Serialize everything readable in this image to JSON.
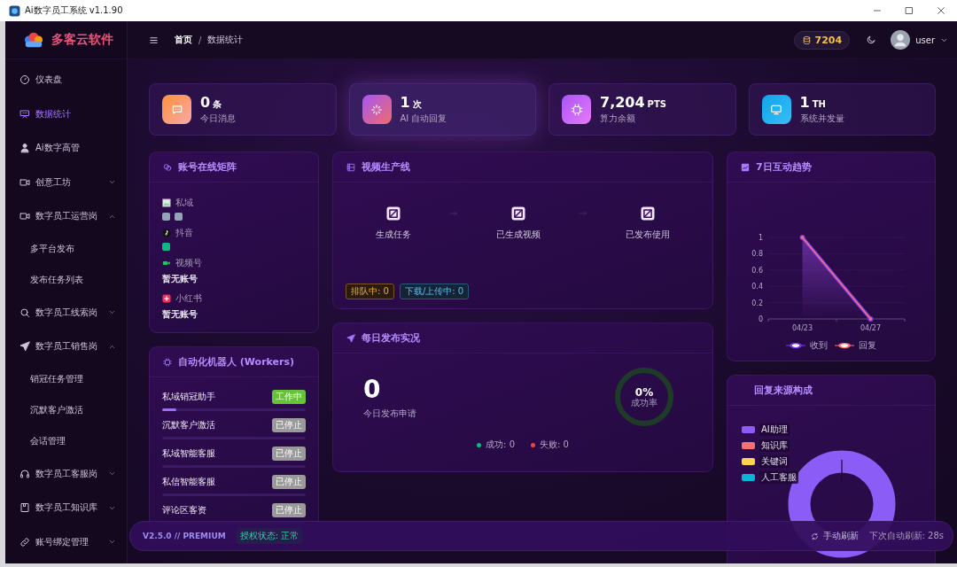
{
  "window": {
    "title": "Ai数字员工系统 v1.1.90"
  },
  "sidebar": {
    "brand": "多客云软件",
    "items": [
      {
        "label": "仪表盘",
        "selected": false
      },
      {
        "label": "数据统计",
        "selected": true
      },
      {
        "label": "Ai数字高管",
        "selected": false
      },
      {
        "label": "创意工坊",
        "selected": false,
        "expanded": false
      },
      {
        "label": "数字员工运营岗",
        "selected": false,
        "expanded": true,
        "children": [
          {
            "label": "多平台发布"
          },
          {
            "label": "发布任务列表"
          }
        ]
      },
      {
        "label": "数字员工线索岗",
        "selected": false,
        "expanded": false
      },
      {
        "label": "数字员工销售岗",
        "selected": false,
        "expanded": true,
        "children": [
          {
            "label": "销冠任务管理"
          },
          {
            "label": "沉默客户激活"
          },
          {
            "label": "会话管理"
          }
        ]
      },
      {
        "label": "数字员工客服岗",
        "selected": false,
        "expanded": false
      },
      {
        "label": "数字员工知识库",
        "selected": false,
        "expanded": false
      },
      {
        "label": "账号绑定管理",
        "selected": false,
        "expanded": false
      }
    ]
  },
  "header": {
    "breadcrumb": [
      "首页",
      "数据统计"
    ],
    "separator": "/",
    "points": "7204",
    "user": "user"
  },
  "stats": [
    {
      "value": "0",
      "unit": "条",
      "label": "今日消息",
      "selected": false
    },
    {
      "value": "1",
      "unit": "次",
      "label": "AI 自动回复",
      "selected": true
    },
    {
      "value": "7,204",
      "unit": "PTS",
      "label": "算力余额",
      "selected": false
    },
    {
      "value": "1",
      "unit": "TH",
      "label": "系统并发量",
      "selected": false
    }
  ],
  "accounts": {
    "title": "账号在线矩阵",
    "platforms": [
      {
        "name": "私域",
        "accounts": [
          {
            "color": "#94a3b8"
          },
          {
            "color": "#94a3b8"
          }
        ]
      },
      {
        "name": "抖音",
        "accounts": [
          {
            "color": "#10b981"
          }
        ]
      },
      {
        "name": "视频号",
        "empty_text": "暂无账号"
      },
      {
        "name": "小红书",
        "empty_text": "暂无账号"
      }
    ]
  },
  "workers": {
    "title": "自动化机器人 (Workers)",
    "items": [
      {
        "name": "私域销冠助手",
        "status": "工作中",
        "on": true,
        "level": 0.1
      },
      {
        "name": "沉默客户激活",
        "status": "已停止",
        "on": false
      },
      {
        "name": "私域智能客服",
        "status": "已停止",
        "on": false
      },
      {
        "name": "私信智能客服",
        "status": "已停止",
        "on": false
      },
      {
        "name": "评论区客资",
        "status": "已停止",
        "on": false
      }
    ]
  },
  "pipeline": {
    "title": "视频生产线",
    "steps": [
      "生成任务",
      "已生成视频",
      "已发布使用"
    ],
    "badges": [
      {
        "label": "排队中: 0",
        "kind": "queue"
      },
      {
        "label": "下载/上传中: 0",
        "kind": "transfer"
      }
    ]
  },
  "publish": {
    "title": "每日发布实况",
    "count": "0",
    "count_label": "今日发布申请",
    "rate": "0%",
    "rate_label": "成功率",
    "legend": [
      {
        "label": "成功: 0",
        "color": "#10b981"
      },
      {
        "label": "失败: 0",
        "color": "#ef4444"
      }
    ]
  },
  "trend": {
    "title": "7日互动趋势",
    "chart_data": {
      "type": "line",
      "categories": [
        "04/23",
        "04/27"
      ],
      "ylim": [
        0,
        1
      ],
      "yticks": [
        0,
        0.2,
        0.4,
        0.6,
        0.8,
        1
      ],
      "grid": true,
      "legend": true,
      "series": [
        {
          "name": "收到",
          "color": "#7c3aed",
          "values": [
            1,
            0
          ],
          "marker": true
        },
        {
          "name": "回复",
          "color": "#f87171",
          "values": [
            1,
            0
          ],
          "marker": true
        }
      ]
    }
  },
  "sources": {
    "title": "回复来源构成",
    "legend": [
      {
        "label": "AI助理",
        "color": "#8b5cf6"
      },
      {
        "label": "知识库",
        "color": "#f87171"
      },
      {
        "label": "关键词",
        "color": "#fcd34d"
      },
      {
        "label": "人工客服",
        "color": "#06b6d4"
      }
    ]
  },
  "footer": {
    "version": "V2.5.0 // PREMIUM",
    "license": "授权状态: 正常",
    "refresh": "手动刷新",
    "countdown": "下次自动刷新: 28s"
  }
}
